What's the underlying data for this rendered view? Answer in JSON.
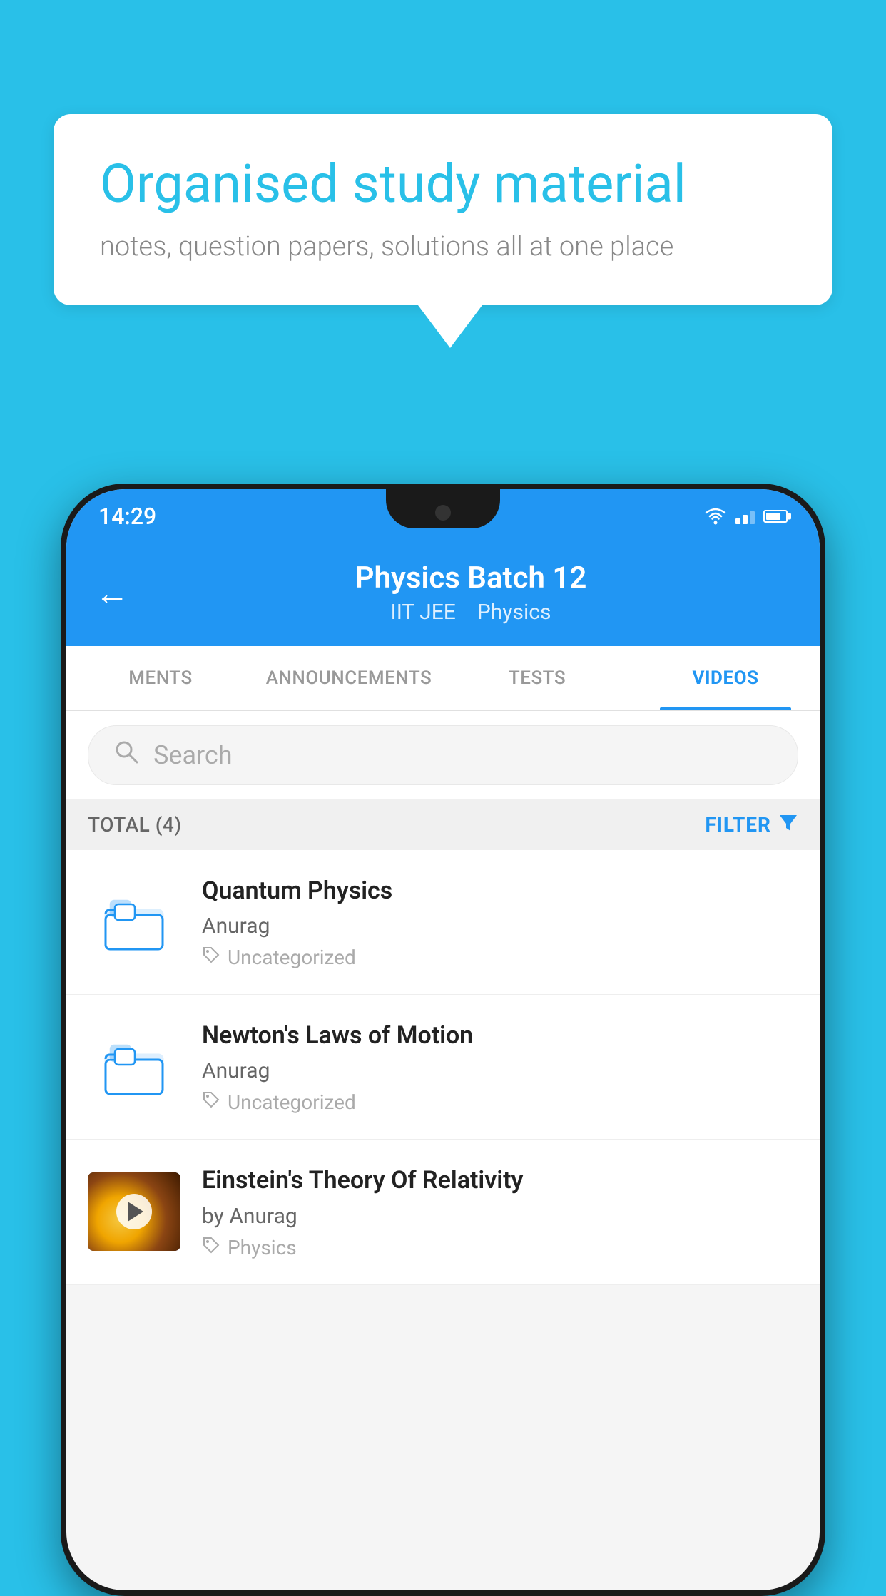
{
  "background": {
    "color": "#29C0E8"
  },
  "speech_bubble": {
    "title": "Organised study material",
    "subtitle": "notes, question papers, solutions all at one place"
  },
  "phone": {
    "status_bar": {
      "time": "14:29"
    },
    "app_bar": {
      "title": "Physics Batch 12",
      "subtitle1": "IIT JEE",
      "subtitle2": "Physics",
      "back_label": "←"
    },
    "tabs": [
      {
        "label": "MENTS",
        "active": false
      },
      {
        "label": "ANNOUNCEMENTS",
        "active": false
      },
      {
        "label": "TESTS",
        "active": false
      },
      {
        "label": "VIDEOS",
        "active": true
      }
    ],
    "search": {
      "placeholder": "Search"
    },
    "filter_bar": {
      "total_label": "TOTAL (4)",
      "filter_label": "FILTER"
    },
    "videos": [
      {
        "title": "Quantum Physics",
        "author": "Anurag",
        "tag": "Uncategorized",
        "type": "folder"
      },
      {
        "title": "Newton's Laws of Motion",
        "author": "Anurag",
        "tag": "Uncategorized",
        "type": "folder"
      },
      {
        "title": "Einstein's Theory Of Relativity",
        "author": "by Anurag",
        "tag": "Physics",
        "type": "thumbnail"
      }
    ]
  }
}
